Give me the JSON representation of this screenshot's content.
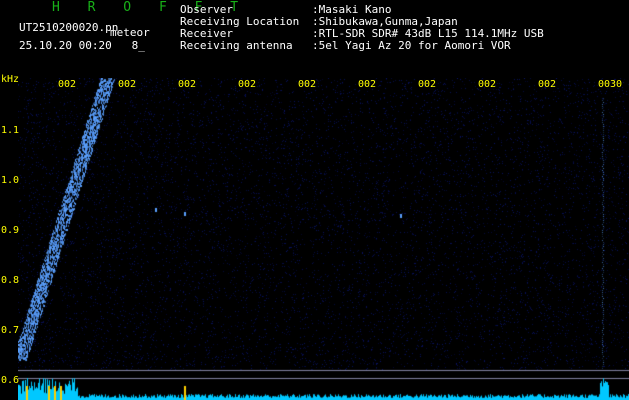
{
  "app": {
    "brand": "H R O F F T",
    "file_name": "UT2510200020.pn",
    "file_suffix": "meteor",
    "datetime": "25.10.20 00:20   8_"
  },
  "header_info": {
    "observer": {
      "label": "Observer",
      "value": ":Masaki Kano"
    },
    "location": {
      "label": "Receiving Location",
      "value": ":Shibukawa,Gunma,Japan"
    },
    "receiver": {
      "label": "Receiver",
      "value": ":RTL-SDR SDR# 43dB L15 114.1MHz USB"
    },
    "antenna": {
      "label": "Receiving antenna",
      "value": ":5el Yagi Az 20 for Aomori VOR"
    }
  },
  "spectrogram": {
    "y_unit": "kHz",
    "y_ticks": [
      "1.1",
      "1.0",
      "0.9",
      "0.8",
      "0.7",
      "0.6"
    ],
    "time_ticks": [
      "002",
      "002",
      "002",
      "002",
      "002",
      "002",
      "002",
      "002",
      "002",
      "0030"
    ],
    "colors": {
      "background": "#000000",
      "noise": "#0a1470",
      "signal": "#5aa0ff",
      "label": "#ffff00",
      "spectrum": "#00c8ff",
      "marker": "#ffd000"
    }
  }
}
